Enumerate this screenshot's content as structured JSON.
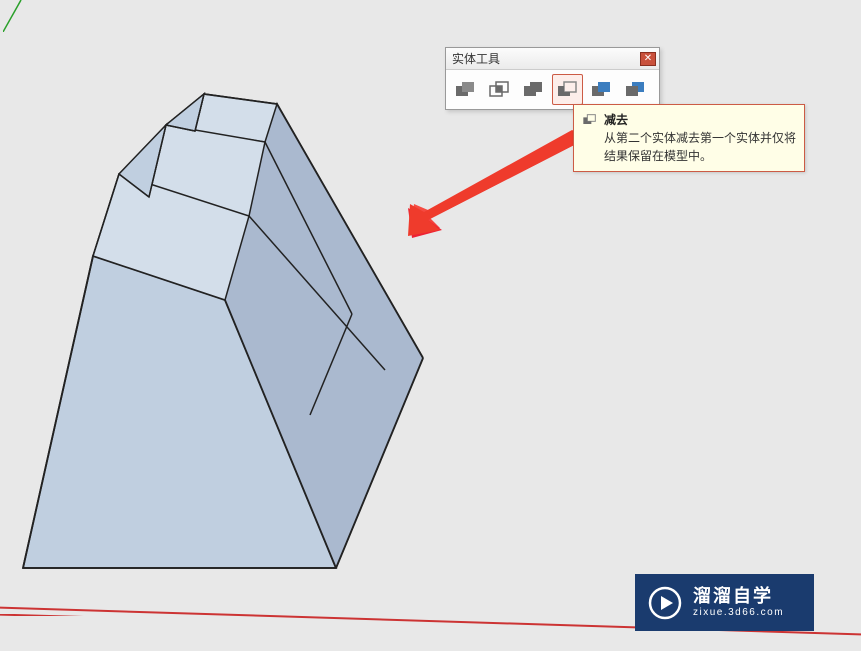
{
  "toolbar": {
    "title": "实体工具",
    "tools": [
      {
        "name": "outer-shell-tool"
      },
      {
        "name": "intersect-tool"
      },
      {
        "name": "union-tool"
      },
      {
        "name": "subtract-tool",
        "selected": true
      },
      {
        "name": "trim-tool"
      },
      {
        "name": "split-tool"
      }
    ]
  },
  "tooltip": {
    "title": "减去",
    "description": "从第二个实体减去第一个实体并仅将结果保留在模型中。"
  },
  "watermark": {
    "title": "溜溜自学",
    "url": "zixue.3d66.com"
  }
}
